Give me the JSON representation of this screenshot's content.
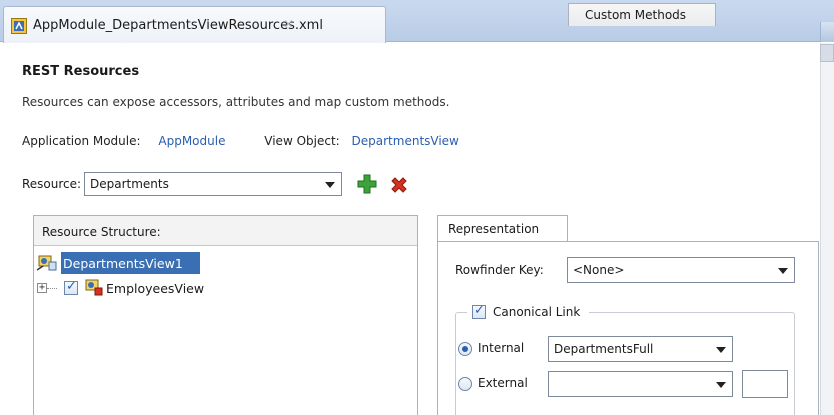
{
  "editor_tab": {
    "title": "AppModule_DepartmentsViewResources.xml",
    "close": "×"
  },
  "page": {
    "heading": "REST Resources",
    "description": "Resources can expose accessors, attributes and map custom methods."
  },
  "info": {
    "app_module_label": "Application Module:",
    "app_module_value": "AppModule",
    "view_object_label": "View Object:",
    "view_object_value": "DepartmentsView"
  },
  "resource": {
    "label": "Resource:",
    "selected": "Departments",
    "add_icon": "green-plus-icon",
    "remove_icon": "red-x-icon"
  },
  "structure": {
    "header": "Resource Structure:",
    "items": [
      {
        "label": "DepartmentsView1",
        "selected": true
      },
      {
        "label": "EmployeesView",
        "checked": true,
        "expandable": true
      }
    ]
  },
  "right_tabs": [
    {
      "label": "Representation",
      "active": true
    },
    {
      "label": "Custom Methods",
      "active": false
    }
  ],
  "representation": {
    "rowfinder_label": "Rowfinder Key:",
    "rowfinder_value": "<None>",
    "canonical_label": "Canonical Link",
    "canonical_checked": true,
    "internal_label": "Internal",
    "internal_value": "DepartmentsFull",
    "internal_selected": true,
    "external_label": "External",
    "external_value": "",
    "external_extra": ""
  },
  "colors": {
    "link": "#2a5db0",
    "selection": "#3b6fb4",
    "tabbar": "#c9d9ef"
  }
}
